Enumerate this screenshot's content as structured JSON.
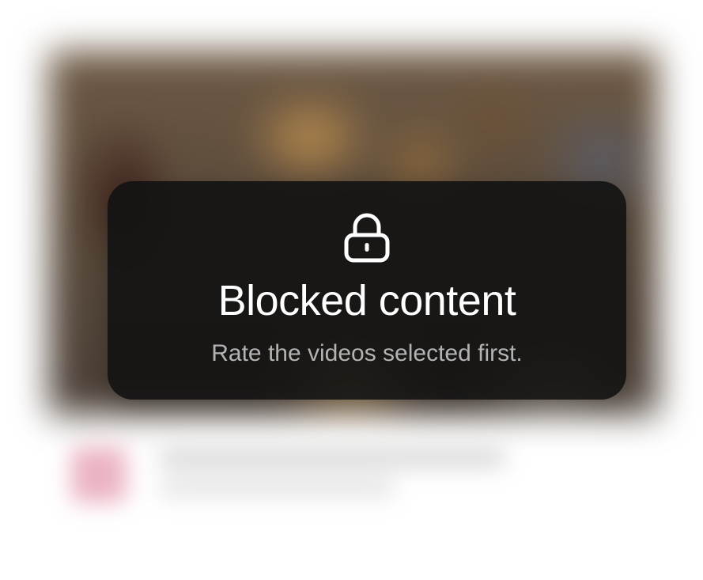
{
  "overlay": {
    "icon": "lock-icon",
    "title": "Blocked content",
    "subtitle": "Rate the videos selected first."
  },
  "colors": {
    "overlay_background": "#121212",
    "title": "#ffffff",
    "subtitle": "#b3b3b3",
    "page_background": "#ffffff"
  }
}
